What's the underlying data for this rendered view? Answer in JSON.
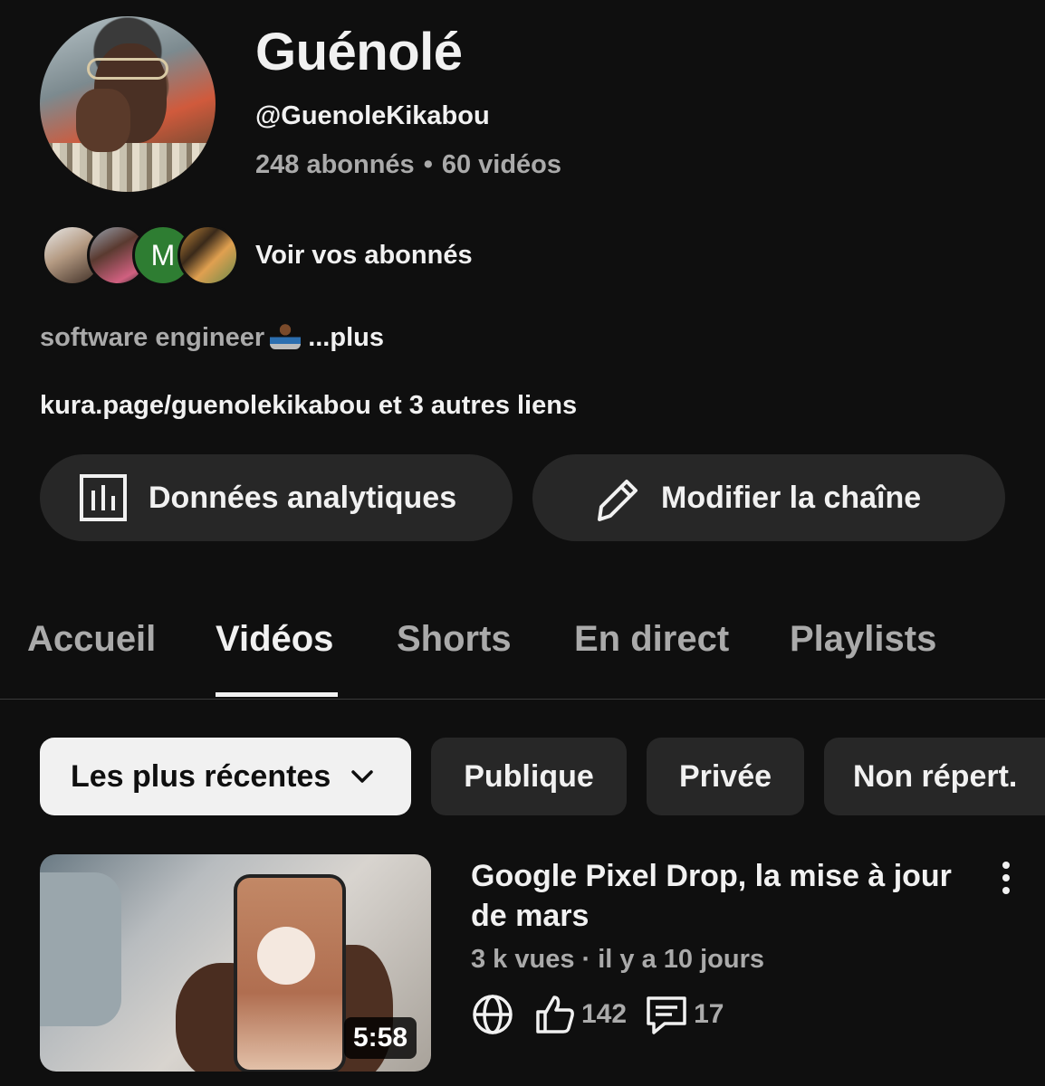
{
  "channel": {
    "name": "Guénolé",
    "handle": "@GuenoleKikabou",
    "subscribers": "248 abonnés",
    "separator": "•",
    "videos": "60 vidéos",
    "subscribers_avatar_letter": "M",
    "see_subscribers": "Voir vos abonnés",
    "description": "software engineer",
    "description_more": "...plus",
    "links": "kura.page/guenolekikabou et 3 autres liens"
  },
  "actions": {
    "analytics": "Données analytiques",
    "edit": "Modifier la chaîne"
  },
  "tabs": [
    {
      "label": "Accueil"
    },
    {
      "label": "Vidéos"
    },
    {
      "label": "Shorts"
    },
    {
      "label": "En direct"
    },
    {
      "label": "Playlists"
    }
  ],
  "active_tab": "Vidéos",
  "filters": {
    "sort": "Les plus récentes",
    "chips": [
      "Publique",
      "Privée",
      "Non répert."
    ]
  },
  "video": {
    "title": "Google Pixel Drop, la mise à jour de mars",
    "meta": "3 k vues · il y a 10 jours",
    "duration": "5:58",
    "likes": "142",
    "comments": "17",
    "visibility_icon": "globe-icon"
  },
  "colors": {
    "background": "#0f0f0f",
    "surface": "#272727",
    "text": "#f1f1f1",
    "muted": "#aaaaaa"
  }
}
